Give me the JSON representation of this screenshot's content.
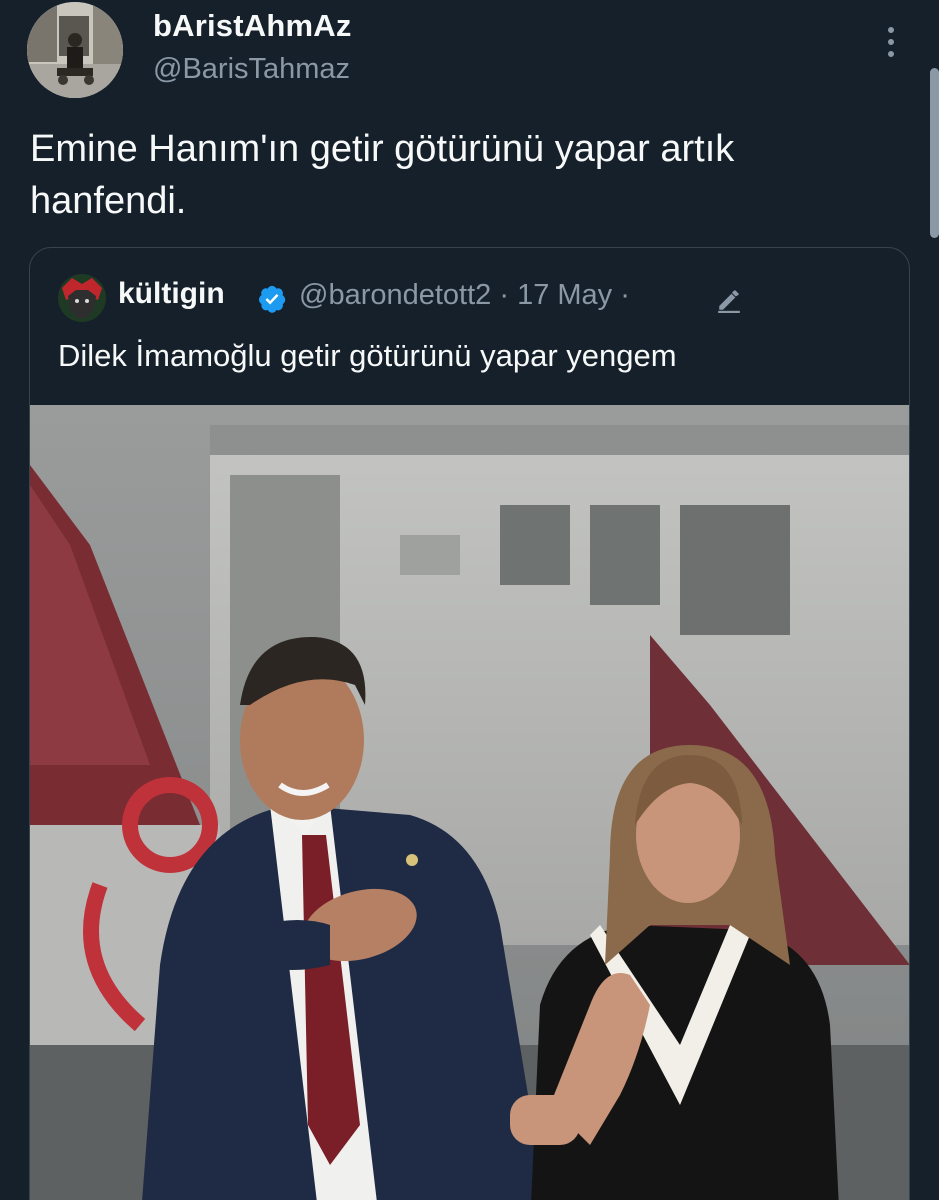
{
  "tweet": {
    "author": {
      "display_name": "bAristAhmAz",
      "handle": "@BarisTahmaz"
    },
    "text_line1": "Emine Hanım'ın getir götürünü yapar artık",
    "text_line2": "hanfendi."
  },
  "quoted_tweet": {
    "author_name": "kültigin",
    "meta": "@barondetott2 · 17 May ·",
    "text": "Dilek İmamoğlu getir götürünü yapar yengem"
  },
  "icons": {
    "more": "more-vertical-icon",
    "verified": "verified-badge-icon",
    "edited": "edit-pencil-icon"
  },
  "colors": {
    "background": "#15202b",
    "text_primary": "#f7f9f9",
    "text_secondary": "#8b98a5",
    "border": "#38444d",
    "verified_blue": "#1d9bf0"
  }
}
